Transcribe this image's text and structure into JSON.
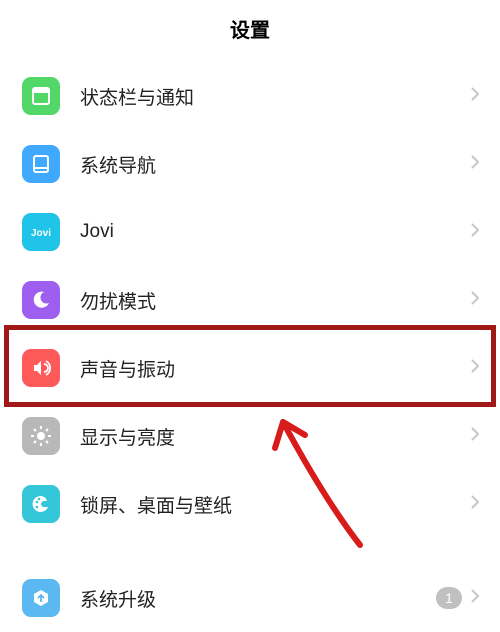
{
  "header": {
    "title": "设置"
  },
  "items": [
    {
      "id": "status-bar",
      "label": "状态栏与通知",
      "icon": "status-icon",
      "iconClass": "ic-status"
    },
    {
      "id": "system-nav",
      "label": "系统导航",
      "icon": "nav-icon",
      "iconClass": "ic-nav"
    },
    {
      "id": "jovi",
      "label": "Jovi",
      "icon": "jovi-icon",
      "iconClass": "ic-jovi"
    },
    {
      "id": "dnd",
      "label": "勿扰模式",
      "icon": "moon-icon",
      "iconClass": "ic-dnd"
    },
    {
      "id": "sound",
      "label": "声音与振动",
      "icon": "sound-icon",
      "iconClass": "ic-sound",
      "highlighted": true
    },
    {
      "id": "display",
      "label": "显示与亮度",
      "icon": "brightness-icon",
      "iconClass": "ic-display"
    },
    {
      "id": "lock",
      "label": "锁屏、桌面与壁纸",
      "icon": "palette-icon",
      "iconClass": "ic-lock"
    }
  ],
  "upgrade": {
    "id": "system-upgrade",
    "label": "系统升级",
    "icon": "upgrade-icon",
    "iconClass": "ic-upgrade",
    "badge": "1"
  },
  "annotation": {
    "highlight_item": "sound",
    "arrow_points_to": "sound"
  }
}
